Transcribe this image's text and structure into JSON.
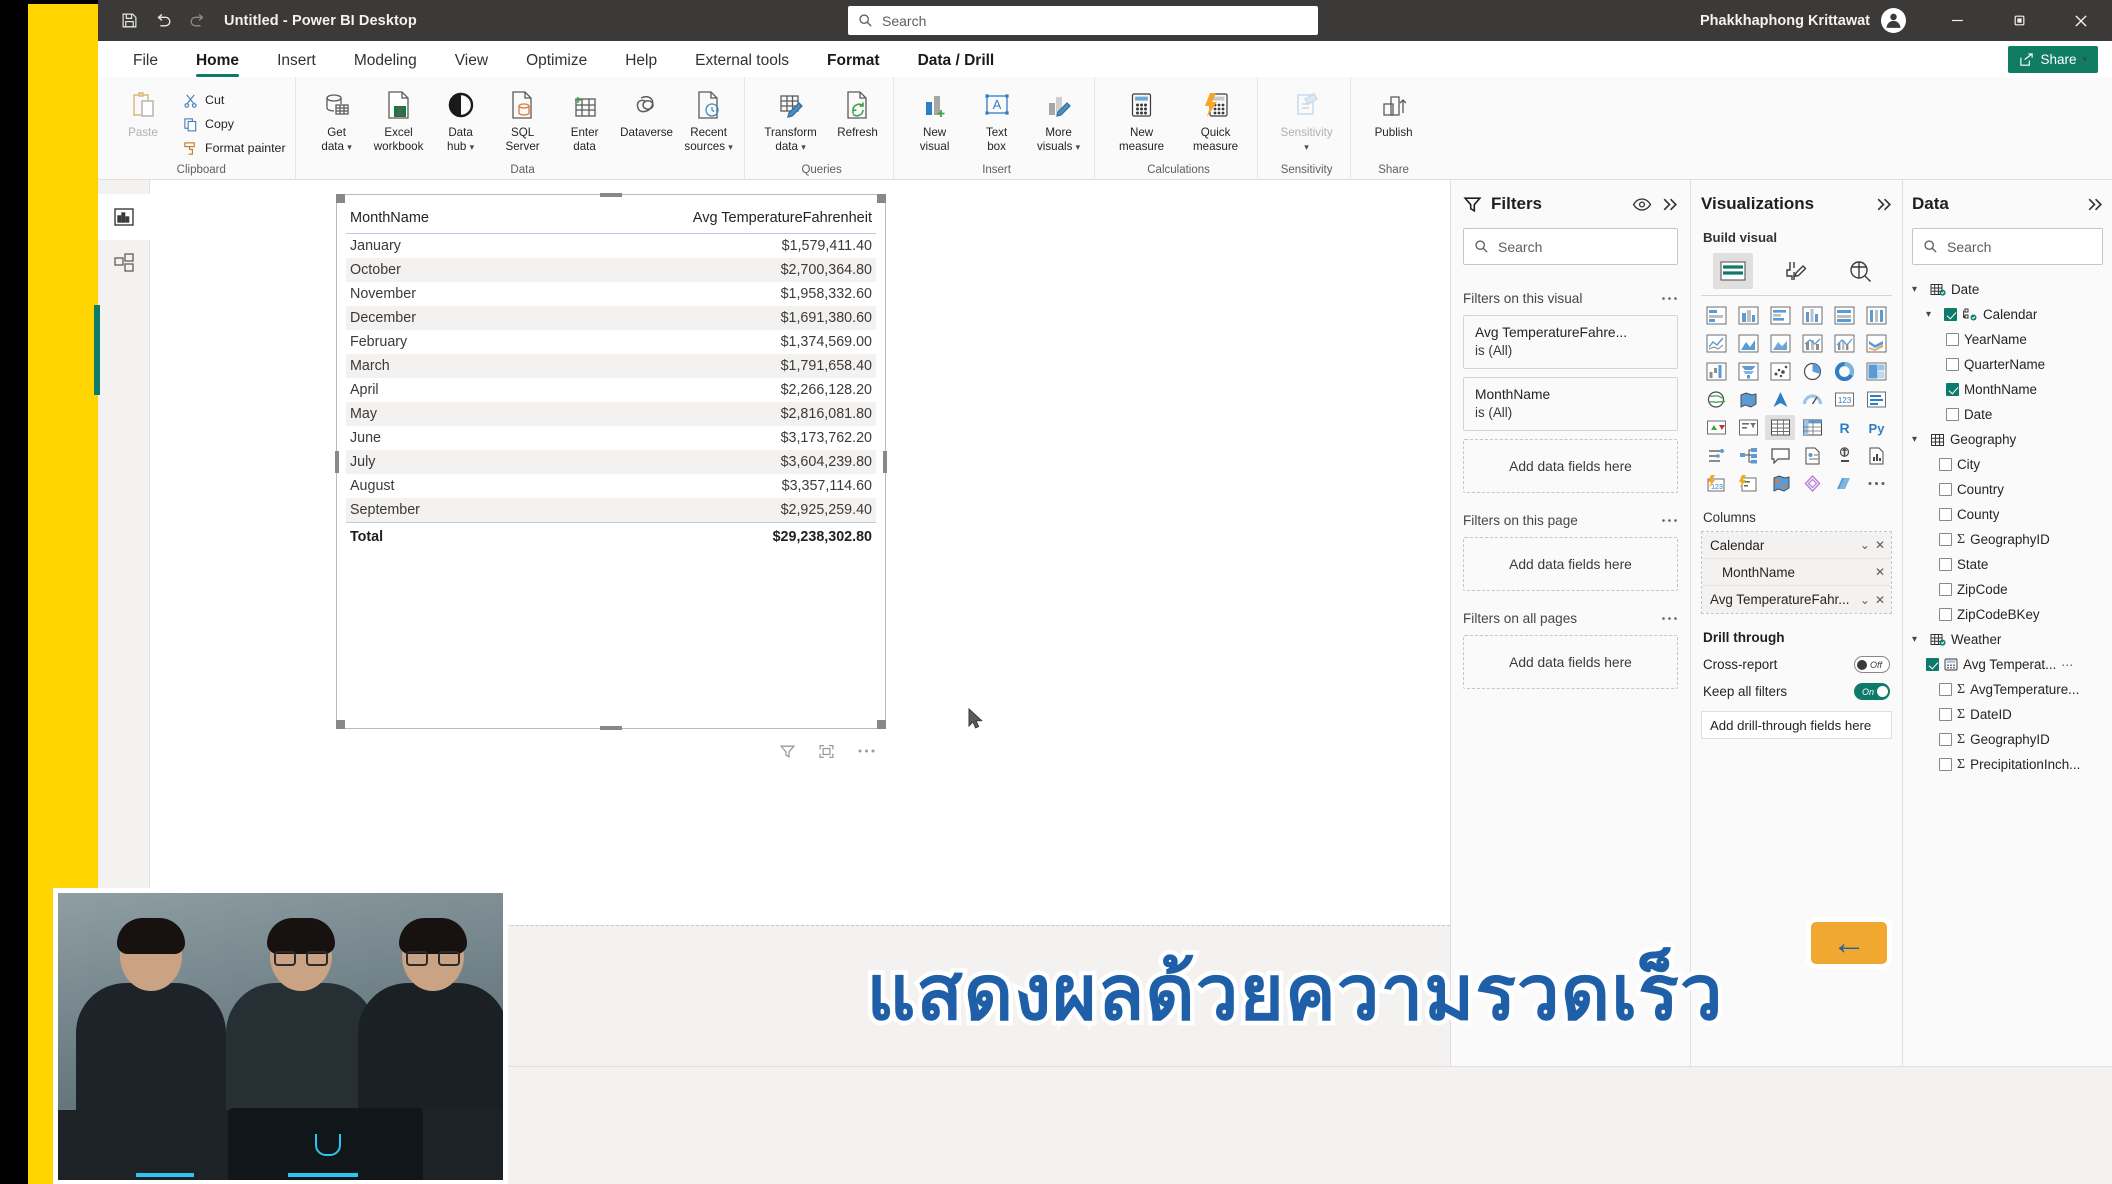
{
  "titlebar": {
    "save_icon": "save-icon",
    "undo_icon": "undo-icon",
    "redo_icon": "redo-icon",
    "title": "Untitled - Power BI Desktop",
    "search_placeholder": "Search",
    "user_name": "Phakkhaphong Krittawat",
    "minimize_label": "—",
    "restore_label": "❐",
    "close_label": "✕"
  },
  "ribbon": {
    "tabs": [
      {
        "label": "File",
        "active": false,
        "contextual": false
      },
      {
        "label": "Home",
        "active": true,
        "contextual": false
      },
      {
        "label": "Insert",
        "active": false,
        "contextual": false
      },
      {
        "label": "Modeling",
        "active": false,
        "contextual": false
      },
      {
        "label": "View",
        "active": false,
        "contextual": false
      },
      {
        "label": "Optimize",
        "active": false,
        "contextual": false
      },
      {
        "label": "Help",
        "active": false,
        "contextual": false
      },
      {
        "label": "External tools",
        "active": false,
        "contextual": false
      },
      {
        "label": "Format",
        "active": false,
        "contextual": true
      },
      {
        "label": "Data / Drill",
        "active": false,
        "contextual": true
      }
    ],
    "share_label": "Share",
    "groups": {
      "clipboard": {
        "label": "Clipboard",
        "paste": "Paste",
        "cut": "Cut",
        "copy": "Copy",
        "format_painter": "Format painter"
      },
      "data": {
        "label": "Data",
        "items": [
          {
            "l1": "Get",
            "l2": "data",
            "caret": true
          },
          {
            "l1": "Excel",
            "l2": "workbook",
            "caret": false
          },
          {
            "l1": "Data",
            "l2": "hub",
            "caret": true
          },
          {
            "l1": "SQL",
            "l2": "Server",
            "caret": false
          },
          {
            "l1": "Enter",
            "l2": "data",
            "caret": false
          },
          {
            "l1": "Dataverse",
            "l2": "",
            "caret": false
          },
          {
            "l1": "Recent",
            "l2": "sources",
            "caret": true
          }
        ]
      },
      "queries": {
        "label": "Queries",
        "items": [
          {
            "l1": "Transform",
            "l2": "data",
            "caret": true
          },
          {
            "l1": "Refresh",
            "l2": "",
            "caret": false
          }
        ]
      },
      "insert": {
        "label": "Insert",
        "items": [
          {
            "l1": "New",
            "l2": "visual",
            "caret": false
          },
          {
            "l1": "Text",
            "l2": "box",
            "caret": false
          },
          {
            "l1": "More",
            "l2": "visuals",
            "caret": true
          }
        ]
      },
      "calculations": {
        "label": "Calculations",
        "items": [
          {
            "l1": "New",
            "l2": "measure",
            "caret": false
          },
          {
            "l1": "Quick",
            "l2": "measure",
            "caret": false
          }
        ]
      },
      "sensitivity": {
        "label": "Sensitivity",
        "items": [
          {
            "l1": "Sensitivity",
            "l2": "",
            "caret": true
          }
        ]
      },
      "share": {
        "label": "Share",
        "items": [
          {
            "l1": "Publish",
            "l2": "",
            "caret": false
          }
        ]
      }
    }
  },
  "rail": {
    "items": [
      {
        "name": "report-view",
        "active": true
      },
      {
        "name": "model-view",
        "active": false
      }
    ]
  },
  "visual": {
    "columns": [
      "MonthName",
      "Avg TemperatureFahrenheit"
    ],
    "rows": [
      {
        "month": "January",
        "value": "$1,579,411.40"
      },
      {
        "month": "October",
        "value": "$2,700,364.80"
      },
      {
        "month": "November",
        "value": "$1,958,332.60"
      },
      {
        "month": "December",
        "value": "$1,691,380.60"
      },
      {
        "month": "February",
        "value": "$1,374,569.00"
      },
      {
        "month": "March",
        "value": "$1,791,658.40"
      },
      {
        "month": "April",
        "value": "$2,266,128.20"
      },
      {
        "month": "May",
        "value": "$2,816,081.80"
      },
      {
        "month": "June",
        "value": "$3,173,762.20"
      },
      {
        "month": "July",
        "value": "$3,604,239.80"
      },
      {
        "month": "August",
        "value": "$3,357,114.60"
      },
      {
        "month": "September",
        "value": "$2,925,259.40"
      }
    ],
    "total_label": "Total",
    "total_value": "$29,238,302.80",
    "footer_icons": [
      "filter-icon",
      "focus-mode-icon",
      "more-options-icon"
    ]
  },
  "filters_pane": {
    "title": "Filters",
    "search_placeholder": "Search",
    "sections": [
      {
        "label": "Filters on this visual",
        "cards": [
          {
            "field": "Avg TemperatureFahre...",
            "state": "is (All)"
          },
          {
            "field": "MonthName",
            "state": "is (All)"
          }
        ],
        "dropzone": "Add data fields here"
      },
      {
        "label": "Filters on this page",
        "cards": [],
        "dropzone": "Add data fields here"
      },
      {
        "label": "Filters on all pages",
        "cards": [],
        "dropzone": "Add data fields here"
      }
    ]
  },
  "visualizations_pane": {
    "title": "Visualizations",
    "build_visual_label": "Build visual",
    "modes": [
      {
        "name": "build-visual-tab",
        "active": true
      },
      {
        "name": "format-visual-tab",
        "active": false
      },
      {
        "name": "analytics-tab",
        "active": false
      }
    ],
    "gallery": [
      "stacked-bar-chart",
      "stacked-column-chart",
      "clustered-bar-chart",
      "clustered-column-chart",
      "100-stacked-bar-chart",
      "100-stacked-column-chart",
      "line-chart",
      "area-chart",
      "stacked-area-chart",
      "line-stacked-column-chart",
      "line-clustered-column-chart",
      "ribbon-chart",
      "waterfall-chart",
      "funnel-chart",
      "scatter-chart",
      "pie-chart",
      "donut-chart",
      "treemap",
      "map",
      "filled-map",
      "azure-map",
      "gauge",
      "card",
      "multi-row-card",
      "kpi",
      "slicer",
      "table",
      "matrix",
      "r-script-visual",
      "python-visual",
      "key-influencers",
      "decomposition-tree",
      "q-and-a",
      "narrative",
      "smart-narrative",
      "paginated-report",
      "power-apps",
      "power-automate",
      "arcgis-map",
      "deneb",
      "power-bi-visual",
      "more-visuals"
    ],
    "selected_gallery_item": "table",
    "columns_label": "Columns",
    "column_wells": [
      {
        "name": "Calendar",
        "level": 0,
        "has_caret": true,
        "has_remove": true
      },
      {
        "name": "MonthName",
        "level": 1,
        "has_caret": false,
        "has_remove": true
      },
      {
        "name": "Avg TemperatureFahr...",
        "level": 0,
        "has_caret": true,
        "has_remove": true
      }
    ],
    "drill_through_label": "Drill through",
    "cross_report_label": "Cross-report",
    "cross_report_state": "Off",
    "keep_all_filters_label": "Keep all filters",
    "keep_all_filters_state": "On",
    "drill_dropzone": "Add drill-through fields here"
  },
  "data_pane": {
    "title": "Data",
    "search_placeholder": "Search",
    "tree": [
      {
        "label": "Date",
        "type": "table",
        "indent": 0,
        "expanded": true,
        "checkbox": null,
        "badge": true
      },
      {
        "label": "Calendar",
        "type": "hierarchy",
        "indent": 1,
        "expanded": true,
        "checkbox": "checked",
        "badge": true
      },
      {
        "label": "YearName",
        "type": "field",
        "indent": 2,
        "checkbox": "unchecked"
      },
      {
        "label": "QuarterName",
        "type": "field",
        "indent": 2,
        "checkbox": "unchecked"
      },
      {
        "label": "MonthName",
        "type": "field",
        "indent": 2,
        "checkbox": "checked"
      },
      {
        "label": "Date",
        "type": "field",
        "indent": 2,
        "checkbox": "unchecked"
      },
      {
        "label": "Geography",
        "type": "table",
        "indent": 0,
        "expanded": true,
        "checkbox": null
      },
      {
        "label": "City",
        "type": "field",
        "indent": 1,
        "checkbox": "unchecked"
      },
      {
        "label": "Country",
        "type": "field",
        "indent": 1,
        "checkbox": "unchecked"
      },
      {
        "label": "County",
        "type": "field",
        "indent": 1,
        "checkbox": "unchecked"
      },
      {
        "label": "GeographyID",
        "type": "measure",
        "indent": 1,
        "checkbox": "unchecked",
        "sigma": true
      },
      {
        "label": "State",
        "type": "field",
        "indent": 1,
        "checkbox": "unchecked"
      },
      {
        "label": "ZipCode",
        "type": "field",
        "indent": 1,
        "checkbox": "unchecked"
      },
      {
        "label": "ZipCodeBKey",
        "type": "field",
        "indent": 1,
        "checkbox": "unchecked"
      },
      {
        "label": "Weather",
        "type": "table",
        "indent": 0,
        "expanded": true,
        "checkbox": null,
        "badge": true
      },
      {
        "label": "Avg Temperat...",
        "type": "calc-field",
        "indent": 1,
        "checkbox": "checked",
        "more": true
      },
      {
        "label": "AvgTemperature...",
        "type": "measure",
        "indent": 1,
        "checkbox": "unchecked",
        "sigma": true
      },
      {
        "label": "DateID",
        "type": "measure",
        "indent": 1,
        "checkbox": "unchecked",
        "sigma": true
      },
      {
        "label": "GeographyID",
        "type": "measure",
        "indent": 1,
        "checkbox": "unchecked",
        "sigma": true
      },
      {
        "label": "PrecipitationInch...",
        "type": "measure",
        "indent": 1,
        "checkbox": "unchecked",
        "sigma": true
      }
    ]
  },
  "caption": {
    "text": "แสดงผลด้วยความรวดเร็ว",
    "arrow_glyph": "←"
  },
  "colors": {
    "brand_teal": "#0d7a6a",
    "share_green": "#107c62",
    "accent_yellow": "#ffd400",
    "titlebar": "#3b3a39",
    "caption_fill": "#1e5fa8",
    "caption_outline": "#f0a830"
  }
}
